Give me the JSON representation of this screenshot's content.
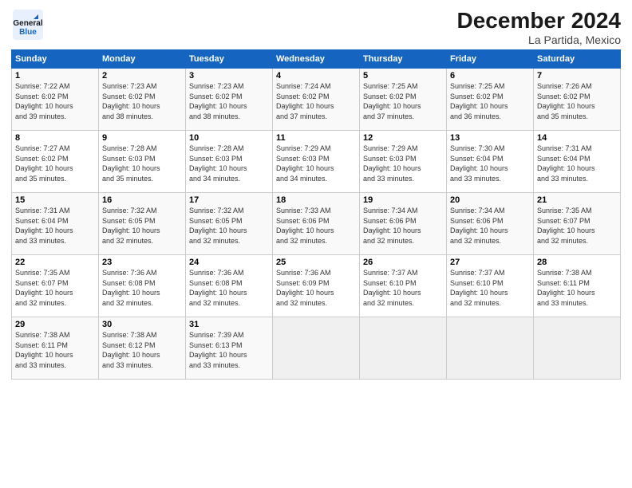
{
  "header": {
    "logo_general": "General",
    "logo_blue": "Blue",
    "title": "December 2024",
    "subtitle": "La Partida, Mexico"
  },
  "days_of_week": [
    "Sunday",
    "Monday",
    "Tuesday",
    "Wednesday",
    "Thursday",
    "Friday",
    "Saturday"
  ],
  "weeks": [
    [
      {
        "day": "1",
        "info": "Sunrise: 7:22 AM\nSunset: 6:02 PM\nDaylight: 10 hours\nand 39 minutes."
      },
      {
        "day": "2",
        "info": "Sunrise: 7:23 AM\nSunset: 6:02 PM\nDaylight: 10 hours\nand 38 minutes."
      },
      {
        "day": "3",
        "info": "Sunrise: 7:23 AM\nSunset: 6:02 PM\nDaylight: 10 hours\nand 38 minutes."
      },
      {
        "day": "4",
        "info": "Sunrise: 7:24 AM\nSunset: 6:02 PM\nDaylight: 10 hours\nand 37 minutes."
      },
      {
        "day": "5",
        "info": "Sunrise: 7:25 AM\nSunset: 6:02 PM\nDaylight: 10 hours\nand 37 minutes."
      },
      {
        "day": "6",
        "info": "Sunrise: 7:25 AM\nSunset: 6:02 PM\nDaylight: 10 hours\nand 36 minutes."
      },
      {
        "day": "7",
        "info": "Sunrise: 7:26 AM\nSunset: 6:02 PM\nDaylight: 10 hours\nand 35 minutes."
      }
    ],
    [
      {
        "day": "8",
        "info": "Sunrise: 7:27 AM\nSunset: 6:02 PM\nDaylight: 10 hours\nand 35 minutes."
      },
      {
        "day": "9",
        "info": "Sunrise: 7:28 AM\nSunset: 6:03 PM\nDaylight: 10 hours\nand 35 minutes."
      },
      {
        "day": "10",
        "info": "Sunrise: 7:28 AM\nSunset: 6:03 PM\nDaylight: 10 hours\nand 34 minutes."
      },
      {
        "day": "11",
        "info": "Sunrise: 7:29 AM\nSunset: 6:03 PM\nDaylight: 10 hours\nand 34 minutes."
      },
      {
        "day": "12",
        "info": "Sunrise: 7:29 AM\nSunset: 6:03 PM\nDaylight: 10 hours\nand 33 minutes."
      },
      {
        "day": "13",
        "info": "Sunrise: 7:30 AM\nSunset: 6:04 PM\nDaylight: 10 hours\nand 33 minutes."
      },
      {
        "day": "14",
        "info": "Sunrise: 7:31 AM\nSunset: 6:04 PM\nDaylight: 10 hours\nand 33 minutes."
      }
    ],
    [
      {
        "day": "15",
        "info": "Sunrise: 7:31 AM\nSunset: 6:04 PM\nDaylight: 10 hours\nand 33 minutes."
      },
      {
        "day": "16",
        "info": "Sunrise: 7:32 AM\nSunset: 6:05 PM\nDaylight: 10 hours\nand 32 minutes."
      },
      {
        "day": "17",
        "info": "Sunrise: 7:32 AM\nSunset: 6:05 PM\nDaylight: 10 hours\nand 32 minutes."
      },
      {
        "day": "18",
        "info": "Sunrise: 7:33 AM\nSunset: 6:06 PM\nDaylight: 10 hours\nand 32 minutes."
      },
      {
        "day": "19",
        "info": "Sunrise: 7:34 AM\nSunset: 6:06 PM\nDaylight: 10 hours\nand 32 minutes."
      },
      {
        "day": "20",
        "info": "Sunrise: 7:34 AM\nSunset: 6:06 PM\nDaylight: 10 hours\nand 32 minutes."
      },
      {
        "day": "21",
        "info": "Sunrise: 7:35 AM\nSunset: 6:07 PM\nDaylight: 10 hours\nand 32 minutes."
      }
    ],
    [
      {
        "day": "22",
        "info": "Sunrise: 7:35 AM\nSunset: 6:07 PM\nDaylight: 10 hours\nand 32 minutes."
      },
      {
        "day": "23",
        "info": "Sunrise: 7:36 AM\nSunset: 6:08 PM\nDaylight: 10 hours\nand 32 minutes."
      },
      {
        "day": "24",
        "info": "Sunrise: 7:36 AM\nSunset: 6:08 PM\nDaylight: 10 hours\nand 32 minutes."
      },
      {
        "day": "25",
        "info": "Sunrise: 7:36 AM\nSunset: 6:09 PM\nDaylight: 10 hours\nand 32 minutes."
      },
      {
        "day": "26",
        "info": "Sunrise: 7:37 AM\nSunset: 6:10 PM\nDaylight: 10 hours\nand 32 minutes."
      },
      {
        "day": "27",
        "info": "Sunrise: 7:37 AM\nSunset: 6:10 PM\nDaylight: 10 hours\nand 32 minutes."
      },
      {
        "day": "28",
        "info": "Sunrise: 7:38 AM\nSunset: 6:11 PM\nDaylight: 10 hours\nand 33 minutes."
      }
    ],
    [
      {
        "day": "29",
        "info": "Sunrise: 7:38 AM\nSunset: 6:11 PM\nDaylight: 10 hours\nand 33 minutes."
      },
      {
        "day": "30",
        "info": "Sunrise: 7:38 AM\nSunset: 6:12 PM\nDaylight: 10 hours\nand 33 minutes."
      },
      {
        "day": "31",
        "info": "Sunrise: 7:39 AM\nSunset: 6:13 PM\nDaylight: 10 hours\nand 33 minutes."
      },
      null,
      null,
      null,
      null
    ]
  ]
}
